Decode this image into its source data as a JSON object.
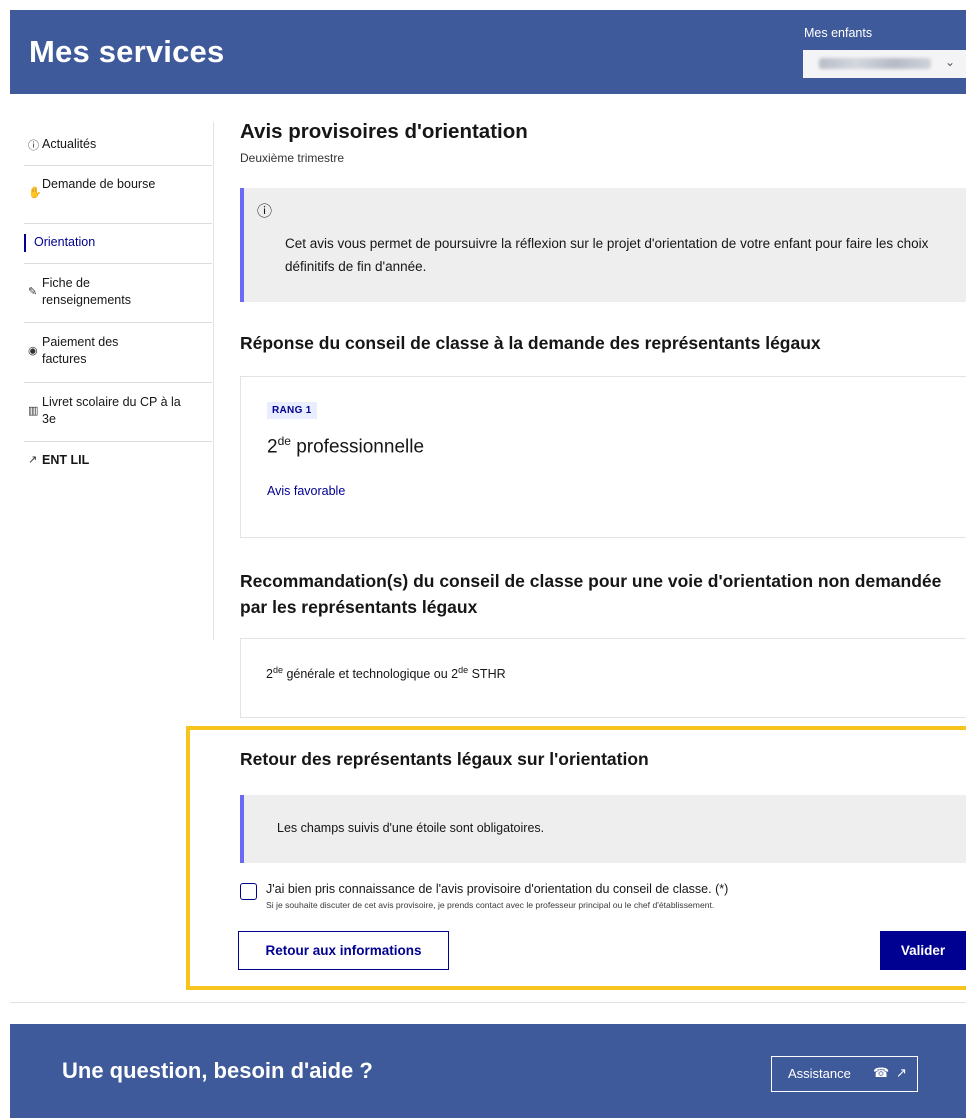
{
  "header": {
    "title": "Mes services",
    "children_label": "Mes enfants",
    "children_select_icon": "chevron-down-icon"
  },
  "sidebar": {
    "items": [
      {
        "label": "Actualités",
        "icon": "info-icon"
      },
      {
        "label": "Demande de bourse",
        "icon": "handshake-icon"
      },
      {
        "label": "Orientation",
        "icon": "",
        "active": true
      },
      {
        "label": "Fiche de renseignements",
        "icon": "edit-icon"
      },
      {
        "label": "Paiement des factures",
        "icon": "coins-icon"
      },
      {
        "label": "Livret scolaire du CP à la 3e",
        "icon": "book-icon"
      },
      {
        "label": "ENT LIL",
        "icon": "external-link-icon"
      }
    ]
  },
  "content": {
    "title": "Avis provisoires d'orientation",
    "subtitle": "Deuxième trimestre",
    "info_text": "Cet avis vous permet de poursuivre la réflexion sur le projet d'orientation de votre enfant pour faire les choix définitifs de fin d'année.",
    "response_section": {
      "title": "Réponse du conseil de classe à la demande des représentants légaux",
      "badge": "RANG 1",
      "choice_prefix": "2",
      "choice_sup": "de",
      "choice_rest": " professionnelle",
      "avis": "Avis favorable"
    },
    "recommendation_section": {
      "title": "Recommandation(s) du conseil de classe pour une voie d'orientation non demandée par les représentants légaux",
      "text_part1": "2",
      "sup1": "de",
      "text_part2": " générale et technologique ou 2",
      "sup2": "de",
      "text_part3": " STHR"
    },
    "feedback_section": {
      "title": "Retour des représentants légaux sur l'orientation",
      "required_notice": "Les champs suivis d'une étoile sont obligatoires.",
      "checkbox_label": "J'ai bien pris connaissance de l'avis provisoire d'orientation du conseil de classe. (*)",
      "checkbox_hint": "Si je souhaite discuter de cet avis provisoire, je prends contact avec le professeur principal ou le chef d'établissement.",
      "back_button": "Retour aux informations",
      "submit_button": "Valider"
    }
  },
  "footer": {
    "title": "Une question, besoin d'aide ?",
    "assistance_label": "Assistance"
  },
  "colors": {
    "brand_blue": "#3f5a9a",
    "action_blue": "#000091",
    "highlight_yellow": "#f7c31d",
    "info_accent": "#6a6af4"
  }
}
